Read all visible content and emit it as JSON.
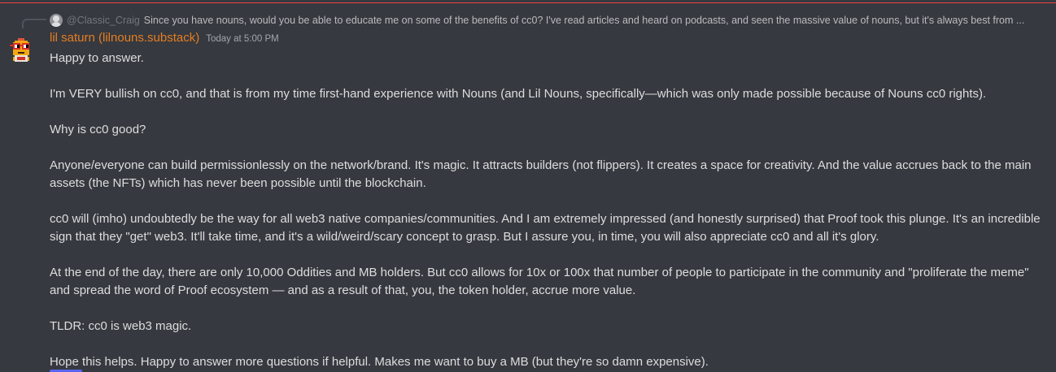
{
  "reply": {
    "author": "@Classic_Craig",
    "text": "Since you have nouns, would you be able to educate me on some of the benefits of cc0? I've read articles and heard on podcasts, and seen the massive value of nouns, but it's always best from ..."
  },
  "message": {
    "author": "lil saturn (lilnouns.substack)",
    "timestamp": "Today at 5:00 PM",
    "author_color": "#e67e22",
    "paragraphs": [
      "Happy to answer.",
      "I'm VERY bullish on cc0, and that is from my time first-hand experience with Nouns (and Lil Nouns, specifically—which was only made possible because of Nouns cc0 rights).",
      "Why is cc0 good?",
      "Anyone/everyone can build permissionlessly on the network/brand. It's magic. It attracts builders (not flippers). It creates a space for creativity. And the value accrues back to the main assets (the NFTs) which has never been possible until the blockchain.",
      "cc0 will (imho) undoubtedly be the way for all web3 native companies/communities. And I am extremely impressed (and honestly surprised) that Proof took this plunge. It's an incredible sign that they \"get\" web3. It'll take time, and it's a wild/weird/scary concept to grasp. But I assure you, in time, you will also appreciate cc0 and all it's glory.",
      "At the end of the day, there are only 10,000 Oddities and MB holders. But cc0 allows for 10x or 100x that number of people to participate in the community and \"proliferate the meme\" and spread the word of Proof ecosystem — and as a result of that, you, the token holder, accrue more value.",
      "TLDR: cc0 is web3 magic.",
      "Hope this helps. Happy to answer more questions if helpful. Makes me want to buy a MB (but they're so damn expensive)."
    ]
  },
  "colors": {
    "background": "#36393f",
    "new_message_divider": "#ed4245",
    "text": "#dcddde",
    "muted_text": "#a3a6aa"
  },
  "icons": {
    "reply_avatar": "default-user-avatar-icon",
    "author_avatar": "pixel-noun-avatar-icon"
  }
}
